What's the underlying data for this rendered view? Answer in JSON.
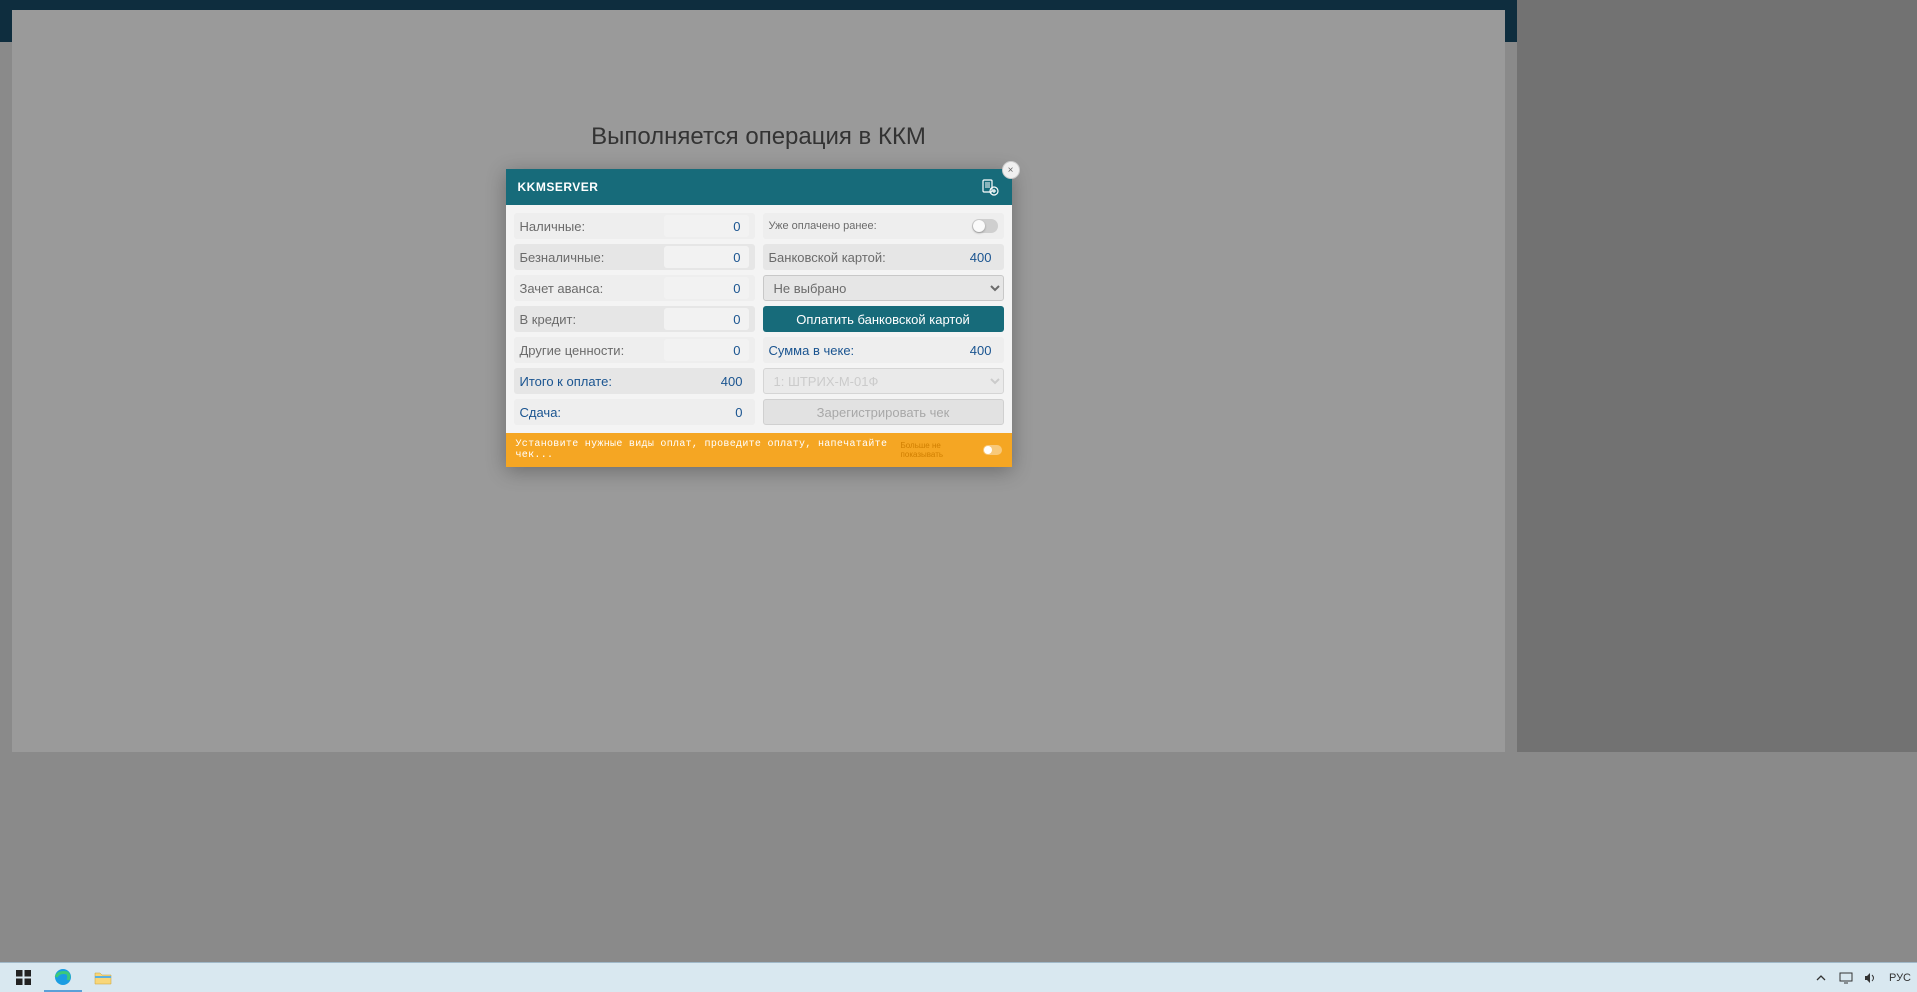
{
  "operation_title": "Выполняется операция в ККМ",
  "modal": {
    "title": "KKMSERVER",
    "close_symbol": "×",
    "left": {
      "cash": {
        "label": "Наличные:",
        "value": "0"
      },
      "noncash": {
        "label": "Безналичные:",
        "value": "0"
      },
      "advance": {
        "label": "Зачет аванса:",
        "value": "0"
      },
      "credit": {
        "label": "В кредит:",
        "value": "0"
      },
      "other": {
        "label": "Другие ценности:",
        "value": "0"
      },
      "total": {
        "label": "Итого к оплате:",
        "value": "400"
      },
      "change": {
        "label": "Сдача:",
        "value": "0"
      }
    },
    "right": {
      "paid_before": {
        "label": "Уже оплачено ранее:"
      },
      "bank_card": {
        "label": "Банковской картой:",
        "value": "400"
      },
      "terminal_select": "Не выбрано",
      "pay_button": "Оплатить банковской картой",
      "sum": {
        "label": "Сумма в чеке:",
        "value": "400"
      },
      "device_select": "1: ШТРИХ-М-01Ф",
      "register_button": "Зарегистрировать чек"
    },
    "footer": {
      "message": "Установите нужные виды оплат, проведите оплату, напечатайте чек...",
      "toggle_label": "Больше не показывать"
    }
  },
  "taskbar": {
    "lang": "РУС"
  }
}
